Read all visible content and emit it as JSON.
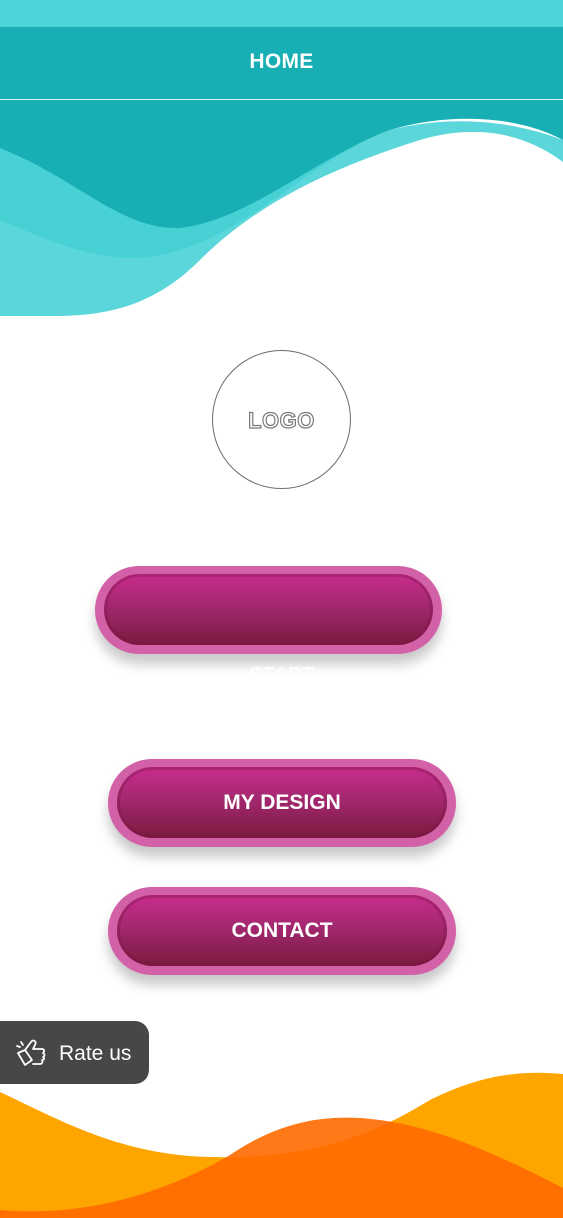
{
  "app_bar": {
    "title": "HOME"
  },
  "logo": {
    "text": "LOGO"
  },
  "buttons": {
    "start_label": "START",
    "my_design_label": "MY DESIGN",
    "contact_label": "CONTACT"
  },
  "rate_us": {
    "label": "Rate us",
    "icon": "thumbs-up-icon"
  },
  "colors": {
    "header_teal": "#17afb3",
    "status_teal": "#4dd4d8",
    "button_magenta": "#c92c8e",
    "wave_orange": "#ffa500",
    "wave_dark_orange": "#ff6a00"
  }
}
